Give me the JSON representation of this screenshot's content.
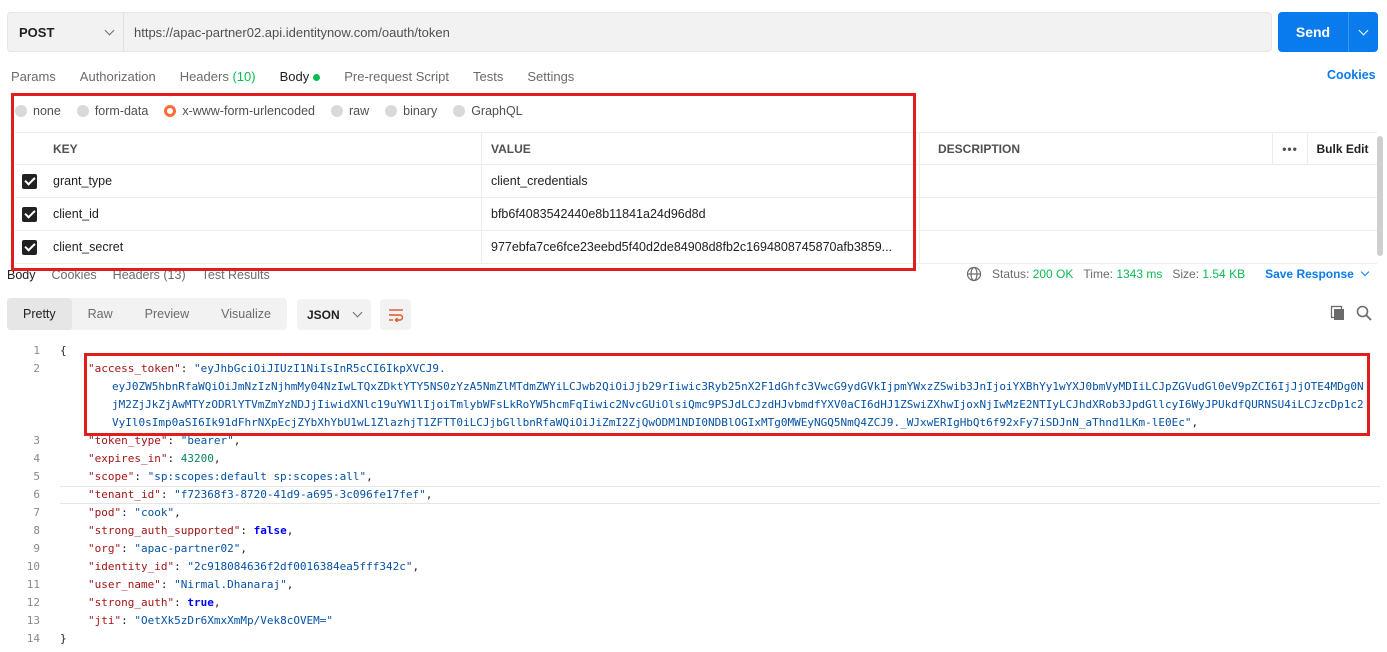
{
  "request": {
    "method": "POST",
    "url": "https://apac-partner02.api.identitynow.com/oauth/token",
    "send_label": "Send"
  },
  "req_tabs": {
    "params": "Params",
    "authorization": "Authorization",
    "headers": "Headers",
    "headers_count": "(10)",
    "body": "Body",
    "prerequest": "Pre-request Script",
    "tests": "Tests",
    "settings": "Settings",
    "cookies": "Cookies"
  },
  "body_types": [
    "none",
    "form-data",
    "x-www-form-urlencoded",
    "raw",
    "binary",
    "GraphQL"
  ],
  "body_type_selected": "x-www-form-urlencoded",
  "table": {
    "headers": {
      "key": "KEY",
      "value": "VALUE",
      "description": "DESCRIPTION",
      "more": "•••",
      "bulk_edit": "Bulk Edit"
    },
    "rows": [
      {
        "key": "grant_type",
        "value": "client_credentials",
        "checked": true
      },
      {
        "key": "client_id",
        "value": "bfb6f4083542440e8b11841a24d96d8d",
        "checked": true
      },
      {
        "key": "client_secret",
        "value": "977ebfa7ce6fce23eebd5f40d2de84908d8fb2c1694808745870afb3859...",
        "checked": true
      }
    ]
  },
  "resp_tabs": {
    "body": "Body",
    "cookies": "Cookies",
    "headers": "Headers (13)",
    "test_results": "Test Results"
  },
  "status": {
    "status_label": "Status:",
    "status_value": "200 OK",
    "time_label": "Time:",
    "time_value": "1343 ms",
    "size_label": "Size:",
    "size_value": "1.54 KB",
    "save_response": "Save Response"
  },
  "view_tabs": [
    "Pretty",
    "Raw",
    "Preview",
    "Visualize"
  ],
  "view_selected": "Pretty",
  "format": "JSON",
  "response_json": {
    "access_token_1": "\"eyJhbGciOiJIUzI1NiIsInR5cCI6IkpXVCJ9.",
    "access_token_2": "eyJ0ZW5hbnRfaWQiOiJmNzIzNjhmMy04NzIwLTQxZDktYTY5NS0zYzA5NmZlMTdmZWYiLCJwb2QiOiJjb29rIiwic3Ryb25nX2F1dGhfc3VwcG9ydGVkIjpmYWxzZSwib3JnIjoiYXBhYy1wYXJ0bmVyMDIiLCJpZGVudGl0eV9pZCI6IjJjOTE4MDg0N",
    "access_token_3": "jM2ZjJkZjAwMTYzODRlYTVmZmYzNDJjIiwidXNlc19uYW1lIjoiTmlybWFsLkRoYW5hcmFqIiwic2NvcGUiOlsiQmc9PSJdLCJzdHJvbmdfYXV0aCI6dHJ1ZSwiZXhwIjoxNjIwMzE2NTIyLCJhdXRob3JpdGllcyI6WyJPUkdfQURNSU4iLCJzcDp1c2",
    "access_token_4": "VyIl0sImp0aSI6Ik91dFhrNXpEcjZYbXhYbU1wL1ZlazhjT1ZFTT0iLCJjbGllbnRfaWQiOiJiZmI2ZjQwODM1NDI0NDBlOGIxMTg0MWEyNGQ5NmQ4ZCJ9._WJxwERIgHbQt6f92xFy7iSDJnN_aThnd1LKm-lE0Ec\"",
    "token_type": "\"bearer\"",
    "expires_in": "43200",
    "scope": "\"sp:scopes:default sp:scopes:all\"",
    "tenant_id": "\"f72368f3-8720-41d9-a695-3c096fe17fef\"",
    "pod": "\"cook\"",
    "strong_auth_supported": "false",
    "org": "\"apac-partner02\"",
    "identity_id": "\"2c918084636f2df0016384ea5fff342c\"",
    "user_name": "\"Nirmal.Dhanaraj\"",
    "strong_auth": "true",
    "jti": "\"OetXk5zDr6XmxXmMp/Vek8cOVEM=\""
  },
  "colors": {
    "accent": "#097bed",
    "status_green": "#0cbb52",
    "radio_selected": "#ff6c37",
    "highlight_red": "#e21d1d"
  },
  "icons": [
    "chevron-down-icon",
    "globe-icon",
    "wrap-icon",
    "copy-icon",
    "search-icon",
    "check-icon"
  ]
}
